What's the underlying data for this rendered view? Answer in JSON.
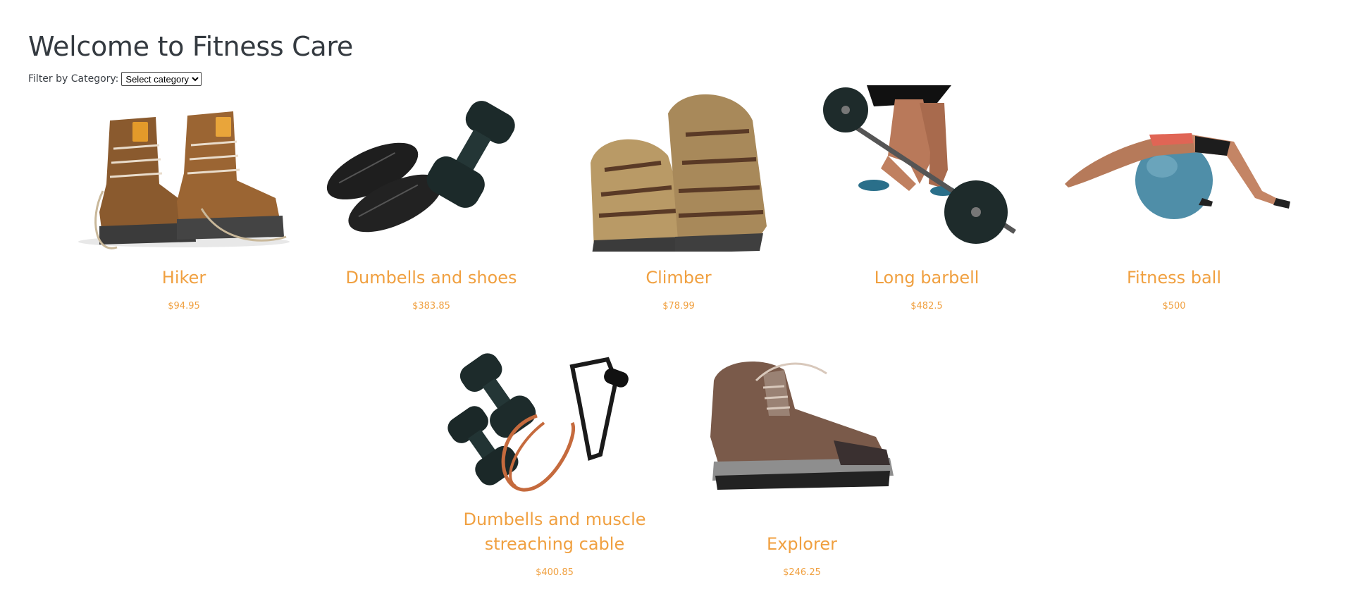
{
  "header": {
    "title": "Welcome to Fitness Care"
  },
  "filter": {
    "label": "Filter by Category:",
    "selected": "Select category"
  },
  "products": [
    {
      "name": "Hiker",
      "price": "$94.95",
      "icon": "hiking-boots-image"
    },
    {
      "name": "Dumbells and shoes",
      "price": "$383.85",
      "icon": "dumbbells-and-shoes-image"
    },
    {
      "name": "Climber",
      "price": "$78.99",
      "icon": "sandals-image"
    },
    {
      "name": "Long barbell",
      "price": "$482.5",
      "icon": "barbell-lift-image"
    },
    {
      "name": "Fitness ball",
      "price": "$500",
      "icon": "fitness-ball-image"
    },
    {
      "name": "Dumbells and muscle streaching cable",
      "price": "$400.85",
      "icon": "dumbbells-and-cable-image"
    },
    {
      "name": "Explorer",
      "price": "$246.25",
      "icon": "hiking-shoe-image"
    }
  ],
  "colors": {
    "accent": "#f0a040",
    "title": "#343a40"
  }
}
